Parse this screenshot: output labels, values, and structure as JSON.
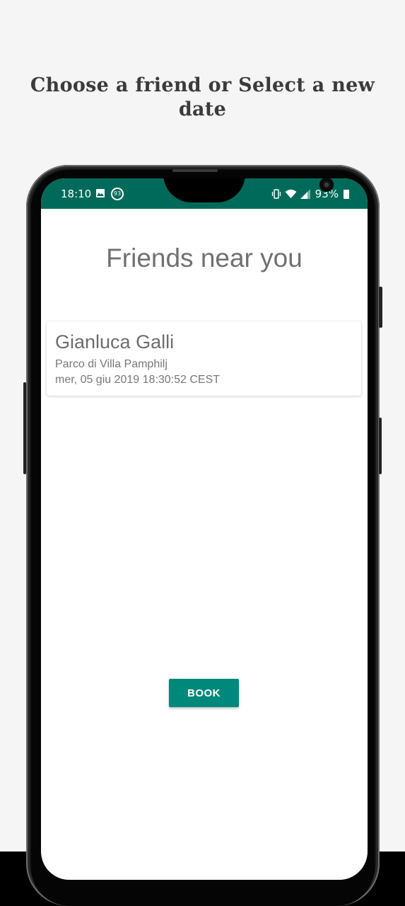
{
  "promo": {
    "headline": "Choose a friend or Select a new date"
  },
  "status_bar": {
    "time": "18:10",
    "notification_badge": "93",
    "battery_percent": "93%",
    "icons": [
      "image-icon",
      "notification-count-icon",
      "vibrate-icon",
      "wifi-icon",
      "signal-icon",
      "battery-icon"
    ],
    "color": "#006a5a"
  },
  "app": {
    "title": "Friends near you",
    "friends": [
      {
        "name": "Gianluca Galli",
        "place": "Parco di Villa Pamphilj",
        "datetime": "mer, 05 giu 2019 18:30:52 CEST"
      }
    ],
    "book_label": "BOOK",
    "accent_color": "#00897b"
  }
}
